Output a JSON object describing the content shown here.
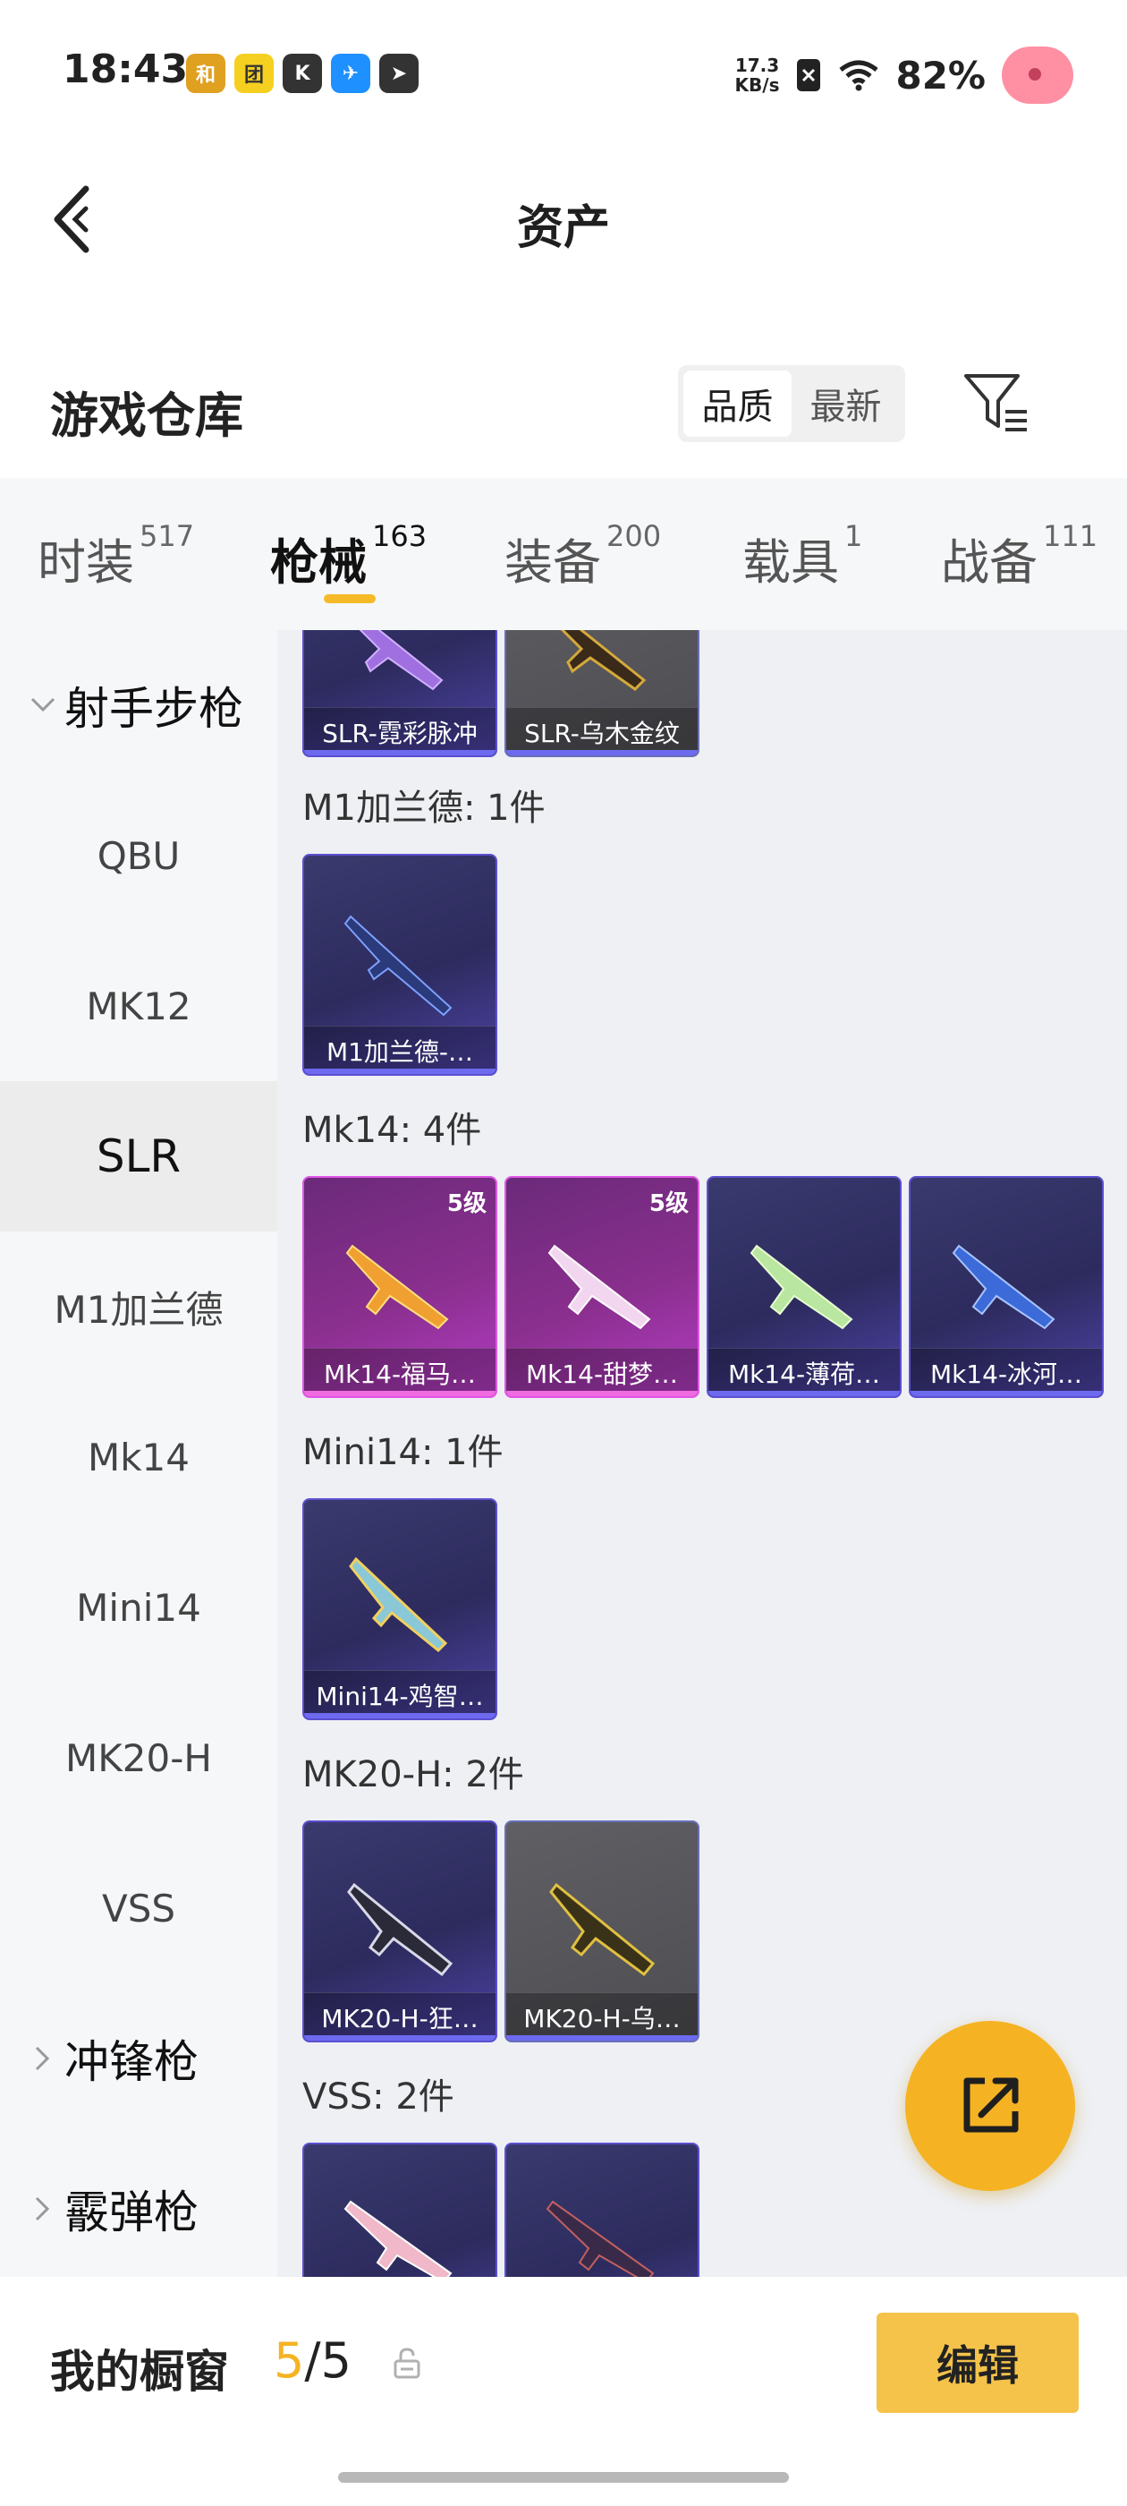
{
  "status_bar": {
    "time": "18:43",
    "app_icons": [
      {
        "name": "game-app-icon",
        "glyph": "和",
        "color": "#e0a020"
      },
      {
        "name": "meituan-app-icon",
        "glyph": "团",
        "color": "#f5d020"
      },
      {
        "name": "kuaishou-app-icon",
        "glyph": "K",
        "color": "#333333"
      },
      {
        "name": "feishu-app-icon",
        "glyph": "✈",
        "color": "#1e90ff"
      },
      {
        "name": "telegram-app-icon",
        "glyph": "➤",
        "color": "#333333"
      }
    ],
    "speed_value": "17.3",
    "speed_unit": "KB/s",
    "battery": "82%"
  },
  "header": {
    "title": "资产"
  },
  "warehouse": {
    "title": "游戏仓库",
    "sort_options": [
      "品质",
      "最新"
    ],
    "active_sort": "品质"
  },
  "tabs": [
    {
      "label": "时装",
      "count": "517"
    },
    {
      "label": "枪械",
      "count": "163",
      "active": true
    },
    {
      "label": "装备",
      "count": "200"
    },
    {
      "label": "载具",
      "count": "1"
    },
    {
      "label": "战备",
      "count": "111"
    }
  ],
  "sidenav": {
    "group_expanded": "射手步枪",
    "items": [
      "QBU",
      "MK12",
      "SLR",
      "M1加兰德",
      "Mk14",
      "Mini14",
      "MK20-H",
      "VSS"
    ],
    "selected": "SLR",
    "groups_collapsed": [
      "冲锋枪",
      "霰弹枪"
    ]
  },
  "sections": [
    {
      "title": "",
      "cards": [
        {
          "label": "SLR-霓彩脉冲",
          "style": "purple"
        },
        {
          "label": "SLR-乌木金纹",
          "style": "gray"
        }
      ]
    },
    {
      "title": "M1加兰德: 1件",
      "cards": [
        {
          "label": "M1加兰德-…",
          "style": "purple"
        }
      ]
    },
    {
      "title": "Mk14: 4件",
      "cards": [
        {
          "label": "Mk14-福马…",
          "style": "pink",
          "level": "5级"
        },
        {
          "label": "Mk14-甜梦…",
          "style": "pink",
          "level": "5级"
        },
        {
          "label": "Mk14-薄荷…",
          "style": "purple"
        },
        {
          "label": "Mk14-冰河…",
          "style": "purple"
        }
      ]
    },
    {
      "title": "Mini14: 1件",
      "cards": [
        {
          "label": "Mini14-鸡智…",
          "style": "purple"
        }
      ]
    },
    {
      "title": "MK20-H: 2件",
      "cards": [
        {
          "label": "MK20-H-狂…",
          "style": "purple"
        },
        {
          "label": "MK20-H-乌…",
          "style": "gray"
        }
      ]
    },
    {
      "title": "VSS: 2件",
      "cards": [
        {
          "label": "",
          "style": "purple"
        },
        {
          "label": "",
          "style": "purple"
        }
      ]
    }
  ],
  "bottom": {
    "window_label": "我的橱窗",
    "count_current": "5",
    "count_sep": "/",
    "count_total": "5",
    "edit_label": "编辑"
  },
  "colors": {
    "accent": "#f5b324",
    "card_purple": "#3a3a6e",
    "card_pink": "#8a2f8e",
    "card_gray": "#55555a"
  }
}
